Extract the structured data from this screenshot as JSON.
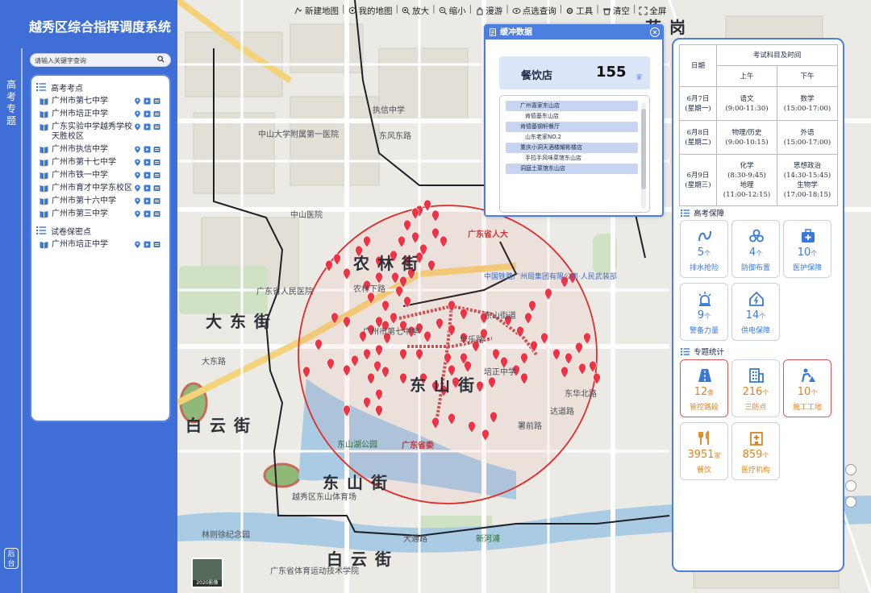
{
  "app": {
    "title": "越秀区综合指挥调度系统",
    "side_tab": "高考专题",
    "bottom_tab": "后台"
  },
  "search": {
    "placeholder": "请输入关键字查询"
  },
  "tree": {
    "groups": [
      {
        "title": "高考考点",
        "schools": [
          "广州市第七中学",
          "广州市培正中学",
          "广东实验中学越秀学校天胜校区",
          "广州市执信中学",
          "广州市第十七中学",
          "广州市铁一中学",
          "广州市育才中学东校区",
          "广州市第十六中学",
          "广州市第三中学"
        ]
      },
      {
        "title": "试卷保密点",
        "schools": [
          "广州市培正中学"
        ]
      }
    ]
  },
  "toolbar": [
    {
      "label": "新建地图",
      "icon": "new-map-icon"
    },
    {
      "label": "我的地图",
      "icon": "my-map-icon"
    },
    {
      "label": "放大",
      "icon": "zoom-in-icon"
    },
    {
      "label": "缩小",
      "icon": "zoom-out-icon"
    },
    {
      "label": "漫游",
      "icon": "pan-icon"
    },
    {
      "label": "点选查询",
      "icon": "point-query-icon"
    },
    {
      "label": "工具",
      "icon": "tools-icon"
    },
    {
      "label": "清空",
      "icon": "clear-icon"
    },
    {
      "label": "全屏",
      "icon": "fullscreen-icon"
    }
  ],
  "buffer": {
    "title": "缓冲数据",
    "category": "餐饮店",
    "count": "155",
    "unit": "家",
    "items": [
      {
        "name": "广州喜家东山店",
        "style": "hl"
      },
      {
        "name": "肯德基东山店",
        "style": "pl"
      },
      {
        "name": "肯德基钢轩餐厅",
        "style": "hl"
      },
      {
        "name": "山东老家NO.2",
        "style": "pl"
      },
      {
        "name": "重庆小洞天酒楼耀彬楼店",
        "style": "hl"
      },
      {
        "name": "手拉手风味菜馆东山店",
        "style": "pl"
      },
      {
        "name": "洞庭土菜馆东山店",
        "style": "hl"
      }
    ]
  },
  "exam": {
    "header": {
      "date": "日期",
      "subject_time": "考试科目及时间",
      "am": "上午",
      "pm": "下午"
    },
    "rows": [
      {
        "date": "6月7日",
        "weekday": "(星期一)",
        "am_subject": "语文",
        "am_time": "(9:00-11:30)",
        "pm_subject": "数学",
        "pm_time": "(15:00-17:00)"
      },
      {
        "date": "6月8日",
        "weekday": "(星期二)",
        "am_subject": "物理/历史",
        "am_time": "(9:00-10:15)",
        "pm_subject": "外语",
        "pm_time": "(15:00-17:00)"
      },
      {
        "date": "6月9日",
        "weekday": "(星期三)",
        "am_subject": "化学",
        "am_time": "(8:30-9:45)",
        "am_subject2": "地理",
        "am_time2": "(11:00-12:15)",
        "pm_subject": "思想政治",
        "pm_time": "(14:30-15:45)",
        "pm_subject2": "生物学",
        "pm_time2": "(17:00-18:15)"
      }
    ]
  },
  "guarantee": {
    "title": "高考保障",
    "cards": [
      {
        "num": "5",
        "unit": "个",
        "label": "排水抢险",
        "icon": "drainage-icon"
      },
      {
        "num": "4",
        "unit": "个",
        "label": "防御布置",
        "icon": "defense-icon"
      },
      {
        "num": "10",
        "unit": "个",
        "label": "医护保障",
        "icon": "medical-kit-icon"
      },
      {
        "num": "9",
        "unit": "个",
        "label": "警备力量",
        "icon": "police-light-icon"
      },
      {
        "num": "14",
        "unit": "个",
        "label": "供电保障",
        "icon": "power-house-icon"
      }
    ]
  },
  "stats": {
    "title": "专题统计",
    "cards": [
      {
        "num": "12",
        "unit": "条",
        "label": "管控路段",
        "icon": "road-icon"
      },
      {
        "num": "216",
        "unit": "个",
        "label": "三防点",
        "icon": "building-icon"
      },
      {
        "num": "10",
        "unit": "个",
        "label": "施工工地",
        "icon": "worker-icon"
      },
      {
        "num": "3951",
        "unit": "家",
        "label": "餐饮",
        "icon": "dining-icon"
      },
      {
        "num": "859",
        "unit": "个",
        "label": "医疗机构",
        "icon": "hospital-icon"
      }
    ]
  },
  "map": {
    "districts": [
      "大东街",
      "农林街",
      "东山街",
      "白云街",
      "东山街",
      "白云街",
      "花岗"
    ],
    "labels": [
      "广东省人大",
      "中国铁路广州局集团有限公司·人民武装部",
      "广东省委",
      "越秀区东山体育场",
      "中山大学附属第一医院",
      "东风东路",
      "中山医院",
      "东山街道",
      "执信中学",
      "广东省人民医院",
      "华乐路",
      "大东路",
      "农林下路",
      "东山湖公园",
      "广州市第七中学",
      "培正中学",
      "大通路",
      "林则徐纪念园",
      "东华北路",
      "署前路",
      "广东省体育运动技术学院",
      "达道路",
      "新河浦"
    ],
    "thumbnail_label": "2020影像",
    "colors": {
      "buffer_circle": "#e02b2b",
      "poi": "#ee3344",
      "boundary": "#222222",
      "road_highlight": "#c8373a"
    }
  }
}
